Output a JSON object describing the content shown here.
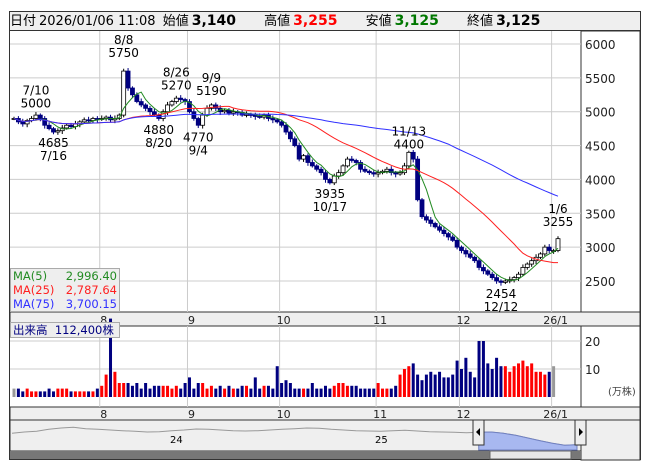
{
  "header": {
    "date_label": "日付",
    "datetime": "2026/01/06 11:08",
    "open_label": "始値",
    "open": "3,140",
    "high_label": "高値",
    "high": "3,255",
    "low_label": "安値",
    "low": "3,125",
    "close_label": "終値",
    "close": "3,125"
  },
  "colors": {
    "up": "#ff0000",
    "down": "#000080",
    "ma5": "#228b22",
    "ma25": "#ff2020",
    "ma75": "#3030ff",
    "flat": "#999999",
    "nav": "#a8b8f0"
  },
  "ma_legend": [
    {
      "name": "MA(5)",
      "value": "2,996.40"
    },
    {
      "name": "MA(25)",
      "value": "2,787.64"
    },
    {
      "name": "MA(75)",
      "value": "3,700.15"
    }
  ],
  "volume_legend": {
    "label": "出来高",
    "value": "112,400株"
  },
  "volume_unit": "(万株)",
  "navigator": {
    "labels": [
      "24",
      "25"
    ],
    "values": [
      4700,
      4900,
      5000,
      5300,
      5500,
      5600,
      5400,
      5300,
      5200,
      5100,
      5000,
      4900,
      4950,
      5100,
      5200,
      5350,
      5300,
      5200,
      5100,
      5050,
      5100,
      5200,
      5300,
      5400,
      5500,
      5450,
      5300,
      5200,
      5100,
      5050,
      5000,
      5100,
      5150,
      5050,
      4950,
      4900,
      4850,
      4800,
      4850,
      4900,
      4700,
      4400,
      4000,
      3600,
      3200,
      2900,
      3000
    ]
  },
  "chart_data": {
    "type": "candlestick",
    "yticks": [
      2500,
      3000,
      3500,
      4000,
      4500,
      5000,
      5500,
      6000
    ],
    "ylim": [
      2150,
      6150
    ],
    "months": [
      {
        "label": "8",
        "index": 20
      },
      {
        "label": "9",
        "index": 40
      },
      {
        "label": "10",
        "index": 61
      },
      {
        "label": "11",
        "index": 83
      },
      {
        "label": "12",
        "index": 102
      },
      {
        "label": "26/1",
        "index": 123
      }
    ],
    "closes": [
      4900,
      4850,
      4820,
      4870,
      4900,
      4950,
      4900,
      4800,
      4750,
      4700,
      4720,
      4760,
      4800,
      4780,
      4820,
      4850,
      4880,
      4870,
      4900,
      4890,
      4900,
      4920,
      4880,
      4900,
      4950,
      5600,
      5350,
      5250,
      5150,
      5100,
      5050,
      5000,
      4950,
      4900,
      5000,
      5100,
      5150,
      5200,
      5180,
      5150,
      5000,
      4900,
      4800,
      4950,
      5050,
      5100,
      5050,
      5000,
      5020,
      4980,
      5000,
      4990,
      4950,
      4960,
      4950,
      4930,
      4920,
      4950,
      4900,
      4880,
      4850,
      4800,
      4700,
      4600,
      4500,
      4300,
      4350,
      4250,
      4200,
      4150,
      4100,
      4000,
      3950,
      4050,
      4100,
      4200,
      4300,
      4280,
      4250,
      4150,
      4120,
      4100,
      4080,
      4100,
      4120,
      4150,
      4100,
      4080,
      4100,
      4200,
      4400,
      4300,
      3700,
      3450,
      3400,
      3350,
      3300,
      3250,
      3200,
      3150,
      3100,
      3000,
      2950,
      2900,
      2850,
      2800,
      2700,
      2650,
      2600,
      2550,
      2500,
      2480,
      2500,
      2520,
      2550,
      2600,
      2700,
      2750,
      2800,
      2850,
      2900,
      3000,
      2950,
      2950,
      3125
    ],
    "volumes": [
      3,
      3,
      2,
      3,
      2,
      2,
      2,
      2,
      3,
      2,
      3,
      3,
      3,
      2,
      2,
      2,
      2,
      2,
      2,
      3,
      4,
      8,
      28,
      9,
      5,
      5,
      5,
      4,
      5,
      3,
      5,
      3,
      4,
      4,
      4,
      4,
      3,
      4,
      3,
      5,
      7,
      3,
      5,
      5,
      3,
      4,
      3,
      4,
      3,
      4,
      3,
      3,
      4,
      4,
      3,
      7,
      3,
      4,
      4,
      3,
      11,
      5,
      6,
      5,
      3,
      3,
      3,
      3,
      5,
      3,
      3,
      4,
      3,
      4,
      5,
      5,
      4,
      4,
      4,
      3,
      3,
      3,
      3,
      5,
      3,
      3,
      3,
      4,
      8,
      10,
      11,
      12,
      8,
      6,
      8,
      9,
      8,
      9,
      7,
      7,
      8,
      13,
      10,
      14,
      9,
      7,
      20,
      20,
      12,
      10,
      14,
      11,
      11,
      9,
      11,
      12,
      13,
      11,
      12,
      9,
      9,
      8,
      9,
      11
    ],
    "ylabel_volume_ticks": [
      10,
      20
    ],
    "annotations": [
      {
        "date": "7/10",
        "price": "5000",
        "index": 5,
        "pos": "above"
      },
      {
        "date": "7/16",
        "price": "4685",
        "index": 9,
        "pos": "below"
      },
      {
        "date": "8/8",
        "price": "5750",
        "index": 25,
        "pos": "above"
      },
      {
        "date": "8/20",
        "price": "4880",
        "index": 33,
        "pos": "below"
      },
      {
        "date": "8/26",
        "price": "5270",
        "index": 37,
        "pos": "above"
      },
      {
        "date": "9/4",
        "price": "4770",
        "index": 42,
        "pos": "below"
      },
      {
        "date": "9/9",
        "price": "5190",
        "index": 45,
        "pos": "above"
      },
      {
        "date": "10/17",
        "price": "3935",
        "index": 72,
        "pos": "below"
      },
      {
        "date": "11/13",
        "price": "4400",
        "index": 90,
        "pos": "above"
      },
      {
        "date": "12/12",
        "price": "2454",
        "index": 111,
        "pos": "below"
      },
      {
        "date": "1/6",
        "price": "3255",
        "index": 124,
        "pos": "above"
      }
    ]
  }
}
